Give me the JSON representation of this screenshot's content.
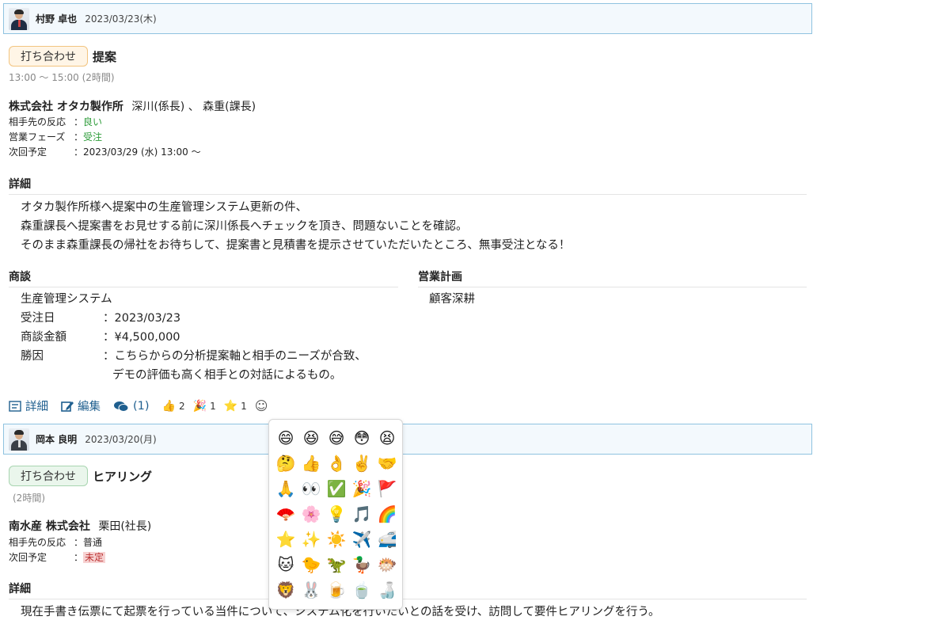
{
  "report1": {
    "user": "村野 卓也",
    "date": "2023/03/23(木)",
    "tag": "打ち合わせ",
    "title": "提案",
    "time": "13:00 ～ 15:00 (2時間)",
    "company": "株式会社 オタカ製作所",
    "contacts": "深川(係長) 、 森重(課長)",
    "reaction_label": "相手先の反応",
    "reaction_value": "良い",
    "phase_label": "営業フェーズ",
    "phase_value": "受注",
    "next_label": "次回予定",
    "next_value": "2023/03/29 (水) 13:00 ～",
    "detail_heading": "詳細",
    "detail_lines": [
      "オタカ製作所様へ提案中の生産管理システム更新の件、",
      "森重課長へ提案書をお見せする前に深川係長へチェックを頂き、問題ないことを確認。",
      "そのまま森重課長の帰社をお待ちして、提案書と見積書を提示させていただいたところ、無事受注となる！"
    ],
    "deal_heading": "商談",
    "deal_name": "生産管理システム",
    "deal_rows": [
      {
        "k": "受注日",
        "v": "：2023/03/23"
      },
      {
        "k": "商談金額",
        "v": "：¥4,500,000"
      },
      {
        "k": "勝因",
        "v": "：こちらからの分析提案軸と相手のニーズが合致、"
      }
    ],
    "deal_cont": "デモの評価も高く相手との対話によるもの。",
    "plan_heading": "営業計画",
    "plan_value": "顧客深耕",
    "actions": {
      "detail": "詳細",
      "edit": "編集",
      "comments": "(1)",
      "reactions": [
        {
          "icon": "👍",
          "count": "2"
        },
        {
          "icon": "🎉",
          "count": "1"
        },
        {
          "icon": "⭐",
          "count": "1"
        }
      ],
      "add_reaction": "☺"
    }
  },
  "report2": {
    "user": "岡本 良明",
    "date": "2023/03/20(月)",
    "tag": "打ち合わせ",
    "title": "ヒアリング",
    "time": "(2時間)",
    "company": "南水産 株式会社",
    "contacts": "栗田(社長)",
    "reaction_label": "相手先の反応",
    "reaction_value": "普通",
    "next_label": "次回予定",
    "next_value": "未定",
    "detail_heading": "詳細",
    "detail_line": "現在手書き伝票にて起票を行っている当件について、システム化を行いたいとの話を受け、訪問して要件ヒアリングを行う。"
  },
  "emoji_picker": [
    "😄",
    "😆",
    "😅",
    "😳",
    "😫",
    "🤔",
    "👍",
    "👌",
    "✌️",
    "🤝",
    "🙏",
    "👀",
    "✅",
    "🎉",
    "🚩",
    "🪭",
    "🌸",
    "💡",
    "🎵",
    "🌈",
    "⭐",
    "✨",
    "☀️",
    "✈️",
    "🚅",
    "🐱",
    "🐤",
    "🦖",
    "🦆",
    "🐡",
    "🦁",
    "🐰",
    "🍺",
    "🍵",
    "🍶"
  ]
}
